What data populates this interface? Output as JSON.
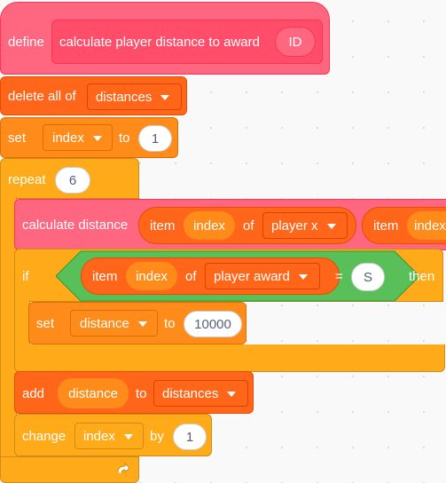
{
  "define": {
    "label": "define",
    "name": "calculate player distance to award",
    "param": "ID"
  },
  "delete_all": {
    "label": "delete all of",
    "list": "distances"
  },
  "set_index": {
    "label": "set",
    "var": "index",
    "to": "to",
    "value": "1"
  },
  "repeat": {
    "label": "repeat",
    "count": "6"
  },
  "calc": {
    "label": "calculate distance",
    "item1": {
      "item": "item",
      "index": "index",
      "of": "of",
      "list": "player x"
    },
    "item2": {
      "item": "item",
      "index": "index"
    }
  },
  "if_block": {
    "if_label": "if",
    "item": "item",
    "index": "index",
    "of": "of",
    "list": "player award",
    "eq": "=",
    "eq_value": "S",
    "then": "then"
  },
  "set_distance": {
    "label": "set",
    "var": "distance",
    "to": "to",
    "value": "10000"
  },
  "add": {
    "label": "add",
    "value": "distance",
    "to": "to",
    "list": "distances"
  },
  "change": {
    "label": "change",
    "var": "index",
    "by": "by",
    "value": "1"
  },
  "icons": {
    "loop_arrow": "loop-arrow-icon",
    "dropdown": "chevron-down-icon"
  },
  "colors": {
    "define_pink": "#ff6680",
    "variables_orange": "#ff8c1a",
    "lists_orange": "#ff661a",
    "control_yellow": "#ffab19",
    "operators_green": "#59c059"
  }
}
